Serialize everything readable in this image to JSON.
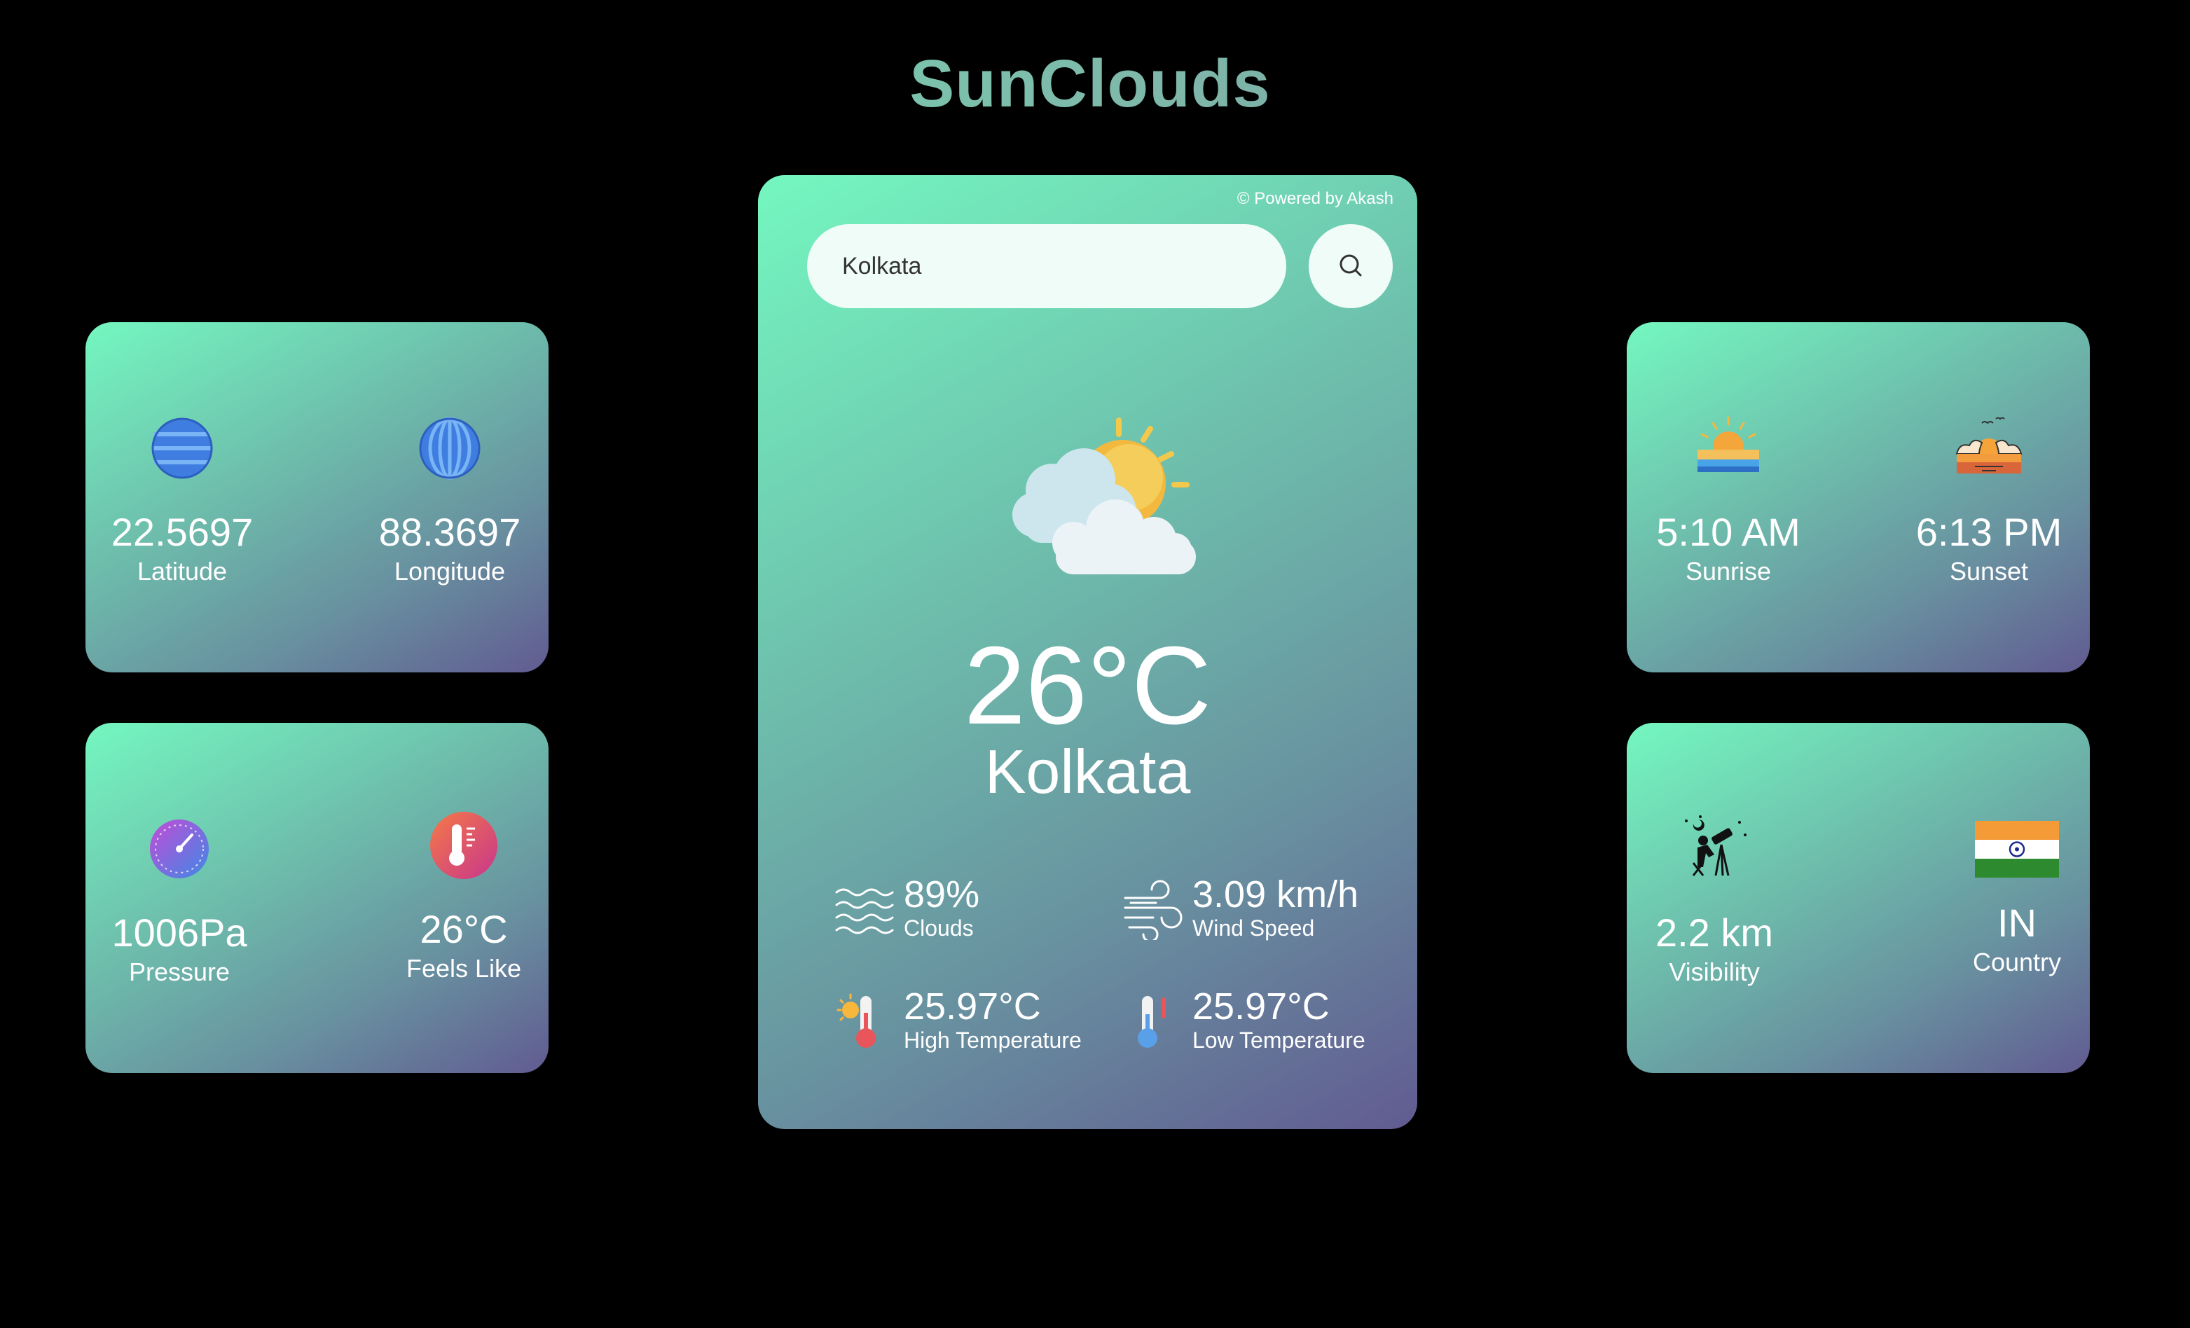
{
  "app": {
    "title": "SunClouds"
  },
  "main": {
    "powered_by": "© Powered by Akash",
    "search_value": "Kolkata",
    "temperature": "26°C",
    "city": "Kolkata",
    "weather_icon": "partly-cloudy-icon",
    "stats": {
      "clouds": {
        "value": "89%",
        "label": "Clouds"
      },
      "wind": {
        "value": "3.09 km/h",
        "label": "Wind Speed"
      },
      "high": {
        "value": "25.97°C",
        "label": "High Temperature"
      },
      "low": {
        "value": "25.97°C",
        "label": "Low Temperature"
      }
    }
  },
  "coords": {
    "latitude": {
      "value": "22.5697",
      "label": "Latitude"
    },
    "longitude": {
      "value": "88.3697",
      "label": "Longitude"
    }
  },
  "atmosphere": {
    "pressure": {
      "value": "1006Pa",
      "label": "Pressure"
    },
    "feels_like": {
      "value": "26°C",
      "label": "Feels Like"
    }
  },
  "sun": {
    "sunrise": {
      "value": "5:10 AM",
      "label": "Sunrise"
    },
    "sunset": {
      "value": "6:13 PM",
      "label": "Sunset"
    }
  },
  "misc": {
    "visibility": {
      "value": "2.2 km",
      "label": "Visibility"
    },
    "country": {
      "value": "IN",
      "label": "Country"
    }
  },
  "colors": {
    "background": "#000000",
    "card_gradient_start": "#74f7c0",
    "card_gradient_end": "#615b91",
    "search_bg": "#effcf7"
  }
}
